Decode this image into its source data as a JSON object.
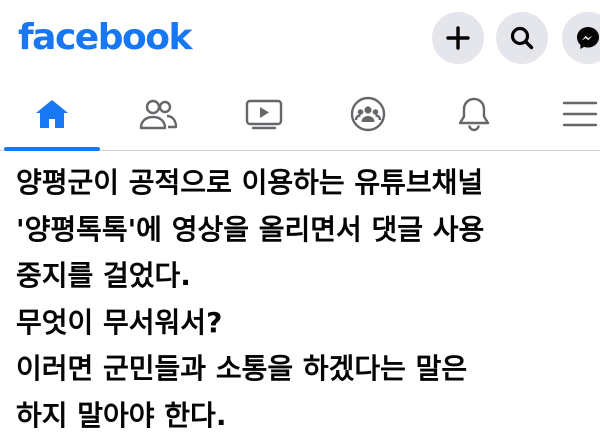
{
  "header": {
    "logo_text": "facebook",
    "accent_color": "#1877f2",
    "actions": [
      {
        "name": "create-button",
        "icon": "plus-icon"
      },
      {
        "name": "search-button",
        "icon": "search-icon"
      },
      {
        "name": "messenger-button",
        "icon": "messenger-icon"
      }
    ]
  },
  "nav": {
    "active_tab": "home",
    "tabs": [
      {
        "id": "home",
        "icon": "home-icon"
      },
      {
        "id": "friends",
        "icon": "friends-icon"
      },
      {
        "id": "video",
        "icon": "video-icon"
      },
      {
        "id": "groups",
        "icon": "groups-icon"
      },
      {
        "id": "notifications",
        "icon": "bell-icon"
      },
      {
        "id": "menu",
        "icon": "menu-icon"
      }
    ]
  },
  "post": {
    "lines": [
      "양평군이 공적으로 이용하는 유튜브채널",
      "'양평톡톡'에 영상을 올리면서 댓글 사용",
      "중지를 걸었다.",
      "무엇이 무서워서?",
      "이러면 군민들과 소통을 하겠다는 말은",
      "하지 말아야 한다."
    ]
  }
}
